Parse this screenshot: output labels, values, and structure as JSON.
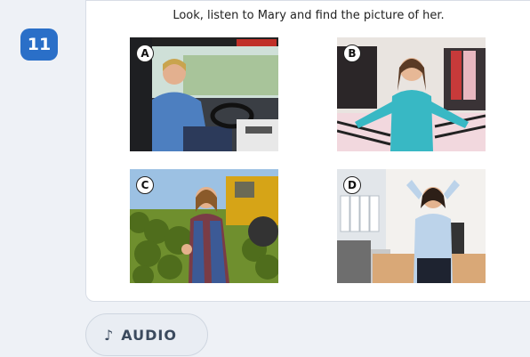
{
  "question": {
    "number": "11",
    "instruction": "Look, listen to Mary and find the picture of her."
  },
  "pictures": [
    {
      "letter": "A",
      "scene": "bus-driver-icon"
    },
    {
      "letter": "B",
      "scene": "shop-assistant-icon"
    },
    {
      "letter": "C",
      "scene": "farmer-icon"
    },
    {
      "letter": "D",
      "scene": "office-worker-icon"
    }
  ],
  "audio": {
    "label": "AUDIO",
    "icon": "music-note-icon"
  },
  "colors": {
    "badge": "#2a6fc8",
    "background": "#eef1f6"
  }
}
